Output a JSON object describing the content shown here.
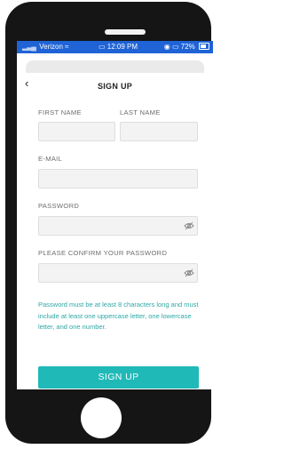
{
  "status_bar": {
    "carrier": "Verizon",
    "time": "12:09 PM",
    "battery": "72%"
  },
  "header": {
    "back_icon": "chevron-left-icon",
    "title": "SIGN UP"
  },
  "form": {
    "first_name_label": "FIRST NAME",
    "last_name_label": "LAST NAME",
    "email_label": "E-MAIL",
    "password_label": "PASSWORD",
    "confirm_password_label": "PLEASE CONFIRM YOUR PASSWORD",
    "password_hint": "Password must be at least 8 characters long and must include at least one uppercase letter, one lowercase letter, and one number.",
    "submit_label": "SIGN UP"
  },
  "colors": {
    "status_bar": "#1f63d6",
    "accent": "#1fb9b7",
    "hint_text": "#2ea7a6",
    "phone_body": "#151515"
  }
}
